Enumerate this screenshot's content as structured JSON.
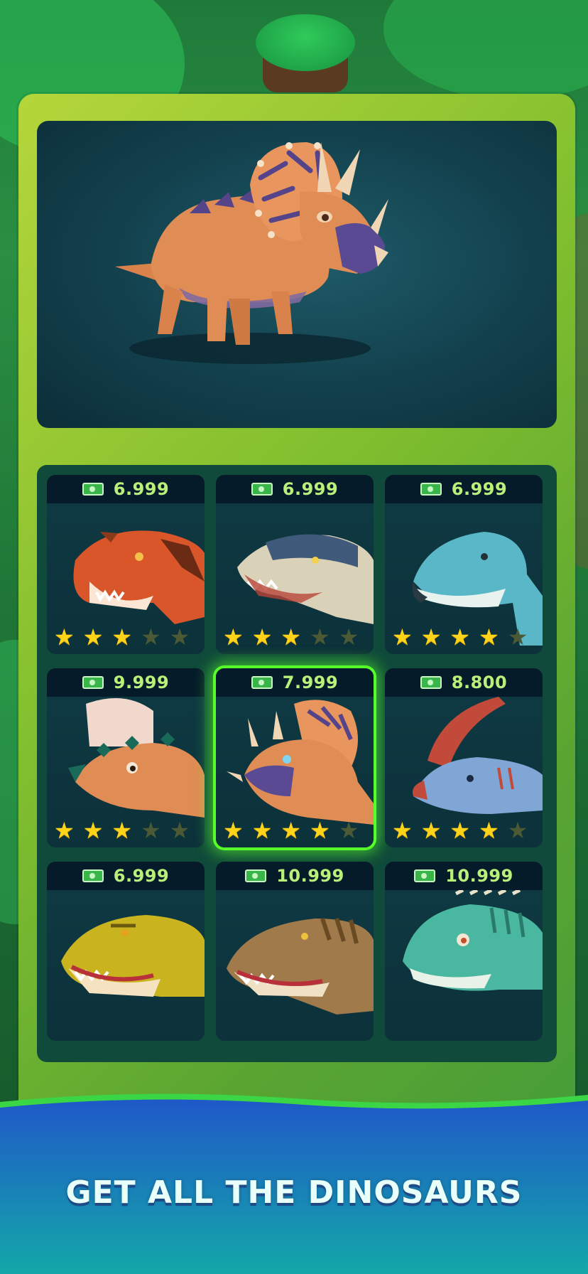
{
  "shop": {
    "featured_dino": "triceratops",
    "cards": [
      {
        "price": "6.999",
        "stars_filled": 3,
        "stars_total": 5,
        "dino": "carnotaurus",
        "selected": false
      },
      {
        "price": "6.999",
        "stars_filled": 3,
        "stars_total": 5,
        "dino": "allosaurus",
        "selected": false
      },
      {
        "price": "6.999",
        "stars_filled": 4,
        "stars_total": 5,
        "dino": "brachiosaurus",
        "selected": false
      },
      {
        "price": "9.999",
        "stars_filled": 3,
        "stars_total": 5,
        "dino": "pachycephalosaurus",
        "selected": false
      },
      {
        "price": "7.999",
        "stars_filled": 4,
        "stars_total": 5,
        "dino": "triceratops",
        "selected": true
      },
      {
        "price": "8.800",
        "stars_filled": 4,
        "stars_total": 5,
        "dino": "parasaurolophus",
        "selected": false
      },
      {
        "price": "6.999",
        "stars_filled": 0,
        "stars_total": 0,
        "dino": "yellow-trex",
        "selected": false
      },
      {
        "price": "10.999",
        "stars_filled": 0,
        "stars_total": 0,
        "dino": "brown-trex",
        "selected": false
      },
      {
        "price": "10.999",
        "stars_filled": 0,
        "stars_total": 0,
        "dino": "green-sauropod",
        "selected": false
      }
    ]
  },
  "tagline": "GET ALL THE DINOSAURS",
  "colors": {
    "price_text": "#b8f07a",
    "star_on": "#ffd31a",
    "star_off": "#4b5a35",
    "selected_glow": "#57ff2a",
    "panel_green": "#7fbe2e",
    "wave_blue": "#1f58c8"
  }
}
